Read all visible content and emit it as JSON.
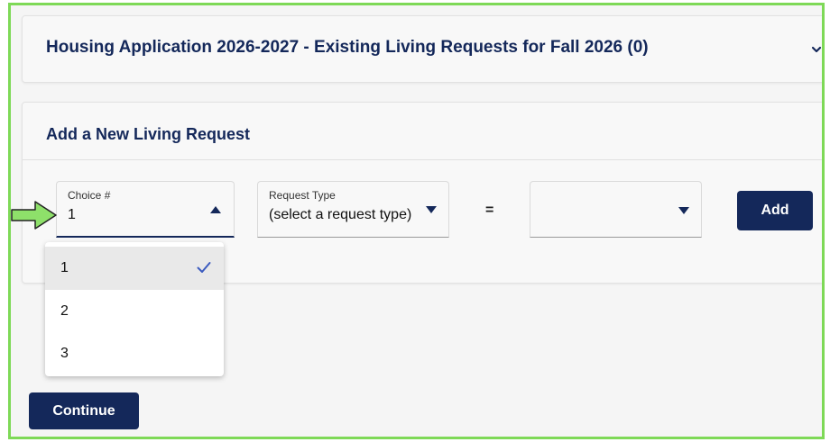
{
  "existing": {
    "title": "Housing Application 2026-2027 - Existing Living Requests for Fall 2026 (0)"
  },
  "new_request": {
    "title": "Add a New Living Request",
    "choice": {
      "label": "Choice #",
      "value": "1",
      "options": [
        "1",
        "2",
        "3"
      ],
      "selected": "1"
    },
    "request_type": {
      "label": "Request Type",
      "value": "(select a request type)"
    },
    "equals": "=",
    "value_field": {
      "value": ""
    },
    "add_label": "Add"
  },
  "continue_label": "Continue",
  "icons": {
    "expand": "chevron-down-icon",
    "caret_up": "caret-up-icon",
    "caret_down": "caret-down-icon",
    "check": "check-icon",
    "pointer": "arrow-right-icon"
  },
  "colors": {
    "navy": "#14285a",
    "highlight_border": "#7ed957",
    "check": "#3b5bbf"
  }
}
